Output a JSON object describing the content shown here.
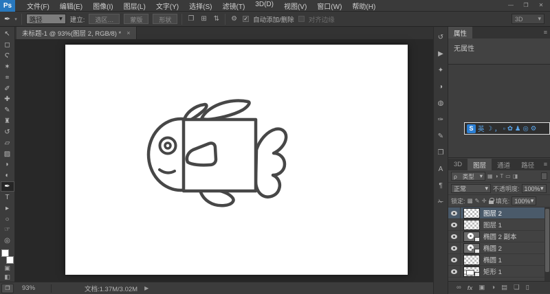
{
  "menu": {
    "logo": "Ps",
    "items": [
      "文件(F)",
      "编辑(E)",
      "图像(I)",
      "图层(L)",
      "文字(Y)",
      "选择(S)",
      "滤镜(T)",
      "3D(D)",
      "视图(V)",
      "窗口(W)",
      "帮助(H)"
    ]
  },
  "window_controls": {
    "minimize": "—",
    "restore": "❐",
    "close": "✕"
  },
  "ui": {
    "dropdown_arrow": "▾",
    "check": "✓",
    "panel_menu": "≡",
    "search_glyph": "ρ"
  },
  "options": {
    "tool_glyph": "✒",
    "mode_value": "路径",
    "make_label": "建立:",
    "make_buttons": [
      "选区…",
      "蒙版",
      "形状"
    ],
    "op_icons": [
      {
        "name": "path-operations-icon",
        "glyph": "❐"
      },
      {
        "name": "path-alignment-icon",
        "glyph": "⊞"
      },
      {
        "name": "path-arrange-icon",
        "glyph": "⇅"
      }
    ],
    "gear_glyph": "⚙",
    "auto_add_label": "自动添加/删除",
    "align_edges_label": "对齐边缘",
    "workspace": "3D"
  },
  "document": {
    "tab_title": "未标题-1 @ 93%(图层 2, RGB/8) *",
    "close": "×"
  },
  "tools": [
    {
      "name": "move-tool",
      "glyph": "↖"
    },
    {
      "name": "marquee-tool",
      "glyph": "◻"
    },
    {
      "name": "lasso-tool",
      "glyph": "Ϛ"
    },
    {
      "name": "quick-selection-tool",
      "glyph": "✶"
    },
    {
      "name": "crop-tool",
      "glyph": "⌗"
    },
    {
      "name": "eyedropper-tool",
      "glyph": "✐"
    },
    {
      "name": "healing-brush-tool",
      "glyph": "✚"
    },
    {
      "name": "brush-tool",
      "glyph": "✎"
    },
    {
      "name": "clone-stamp-tool",
      "glyph": "♜"
    },
    {
      "name": "history-brush-tool",
      "glyph": "↺"
    },
    {
      "name": "eraser-tool",
      "glyph": "▱"
    },
    {
      "name": "gradient-tool",
      "glyph": "▨"
    },
    {
      "name": "blur-tool",
      "glyph": "◗"
    },
    {
      "name": "dodge-tool",
      "glyph": "◐"
    },
    {
      "name": "pen-tool",
      "glyph": "✒"
    },
    {
      "name": "type-tool",
      "glyph": "T"
    },
    {
      "name": "path-selection-tool",
      "glyph": "▸"
    },
    {
      "name": "ellipse-tool",
      "glyph": "○"
    },
    {
      "name": "hand-tool",
      "glyph": "☞"
    },
    {
      "name": "zoom-tool",
      "glyph": "◎"
    }
  ],
  "toolbar_bottom": {
    "quickmask_glyph": "▣",
    "screenmode_glyph": "◧"
  },
  "dock_icons": [
    {
      "name": "history-panel-icon",
      "glyph": "↺"
    },
    {
      "name": "actions-panel-icon",
      "glyph": "▶"
    },
    {
      "name": "styles-panel-icon",
      "glyph": "✦"
    },
    {
      "name": "adjustments-panel-icon",
      "glyph": "◑"
    },
    {
      "name": "info-panel-icon",
      "glyph": "◍"
    },
    {
      "name": "brush-presets-panel-icon",
      "glyph": "✑"
    },
    {
      "name": "brush-panel-icon",
      "glyph": "✎"
    },
    {
      "name": "clone-source-panel-icon",
      "glyph": "❐"
    },
    {
      "name": "character-panel-icon",
      "glyph": "A"
    },
    {
      "name": "paragraph-panel-icon",
      "glyph": "¶"
    },
    {
      "name": "tool-presets-panel-icon",
      "glyph": "✁"
    }
  ],
  "properties": {
    "tab": "属性",
    "empty_text": "无属性"
  },
  "ime": {
    "logo": "S",
    "icons": [
      {
        "name": "ime-mode-icon",
        "glyph": "英"
      },
      {
        "name": "ime-fullhalf-icon",
        "glyph": "☽"
      },
      {
        "name": "ime-punct-icon",
        "glyph": "，"
      },
      {
        "name": "ime-board-icon",
        "glyph": "▫"
      },
      {
        "name": "ime-skin-icon",
        "glyph": "✿"
      },
      {
        "name": "ime-user-icon",
        "glyph": "♟"
      },
      {
        "name": "ime-search-icon",
        "glyph": "◎"
      },
      {
        "name": "ime-settings-icon",
        "glyph": "⚙"
      }
    ]
  },
  "layers_panel": {
    "tabs": [
      "3D",
      "图层",
      "通道",
      "路径"
    ],
    "filter_label": "类型",
    "filter_icons": [
      {
        "name": "filter-pixel-icon",
        "glyph": "▦"
      },
      {
        "name": "filter-adjustment-icon",
        "glyph": "◑"
      },
      {
        "name": "filter-type-icon",
        "glyph": "T"
      },
      {
        "name": "filter-shape-icon",
        "glyph": "▭"
      },
      {
        "name": "filter-smart-icon",
        "glyph": "◨"
      }
    ],
    "blend_mode": "正常",
    "opacity_label": "不透明度:",
    "opacity_value": "100%",
    "lock_label": "锁定:",
    "lock_icons": [
      {
        "name": "lock-transparency-icon",
        "glyph": "▩"
      },
      {
        "name": "lock-paint-icon",
        "glyph": "✎"
      },
      {
        "name": "lock-position-icon",
        "glyph": "✛"
      }
    ],
    "fill_label": "填充:",
    "fill_value": "100%",
    "layers": [
      {
        "name": "图层 2"
      },
      {
        "name": "图层 1"
      },
      {
        "name": "椭圆 2 副本"
      },
      {
        "name": "椭圆 2"
      },
      {
        "name": "椭圆 1"
      },
      {
        "name": "矩形 1"
      }
    ],
    "bottom_icons": [
      {
        "name": "link-layers-icon",
        "glyph": "∞"
      },
      {
        "name": "layer-style-icon",
        "glyph": "fx"
      },
      {
        "name": "add-mask-icon",
        "glyph": "▣"
      },
      {
        "name": "adjustment-layer-icon",
        "glyph": "◑"
      },
      {
        "name": "new-group-icon",
        "glyph": "▤"
      },
      {
        "name": "new-layer-icon",
        "glyph": "❏"
      },
      {
        "name": "delete-layer-icon",
        "glyph": "▯"
      }
    ]
  },
  "status": {
    "zoom": "93%",
    "doc_label": "文档:1.37M/3.02M",
    "expand": "▶"
  }
}
